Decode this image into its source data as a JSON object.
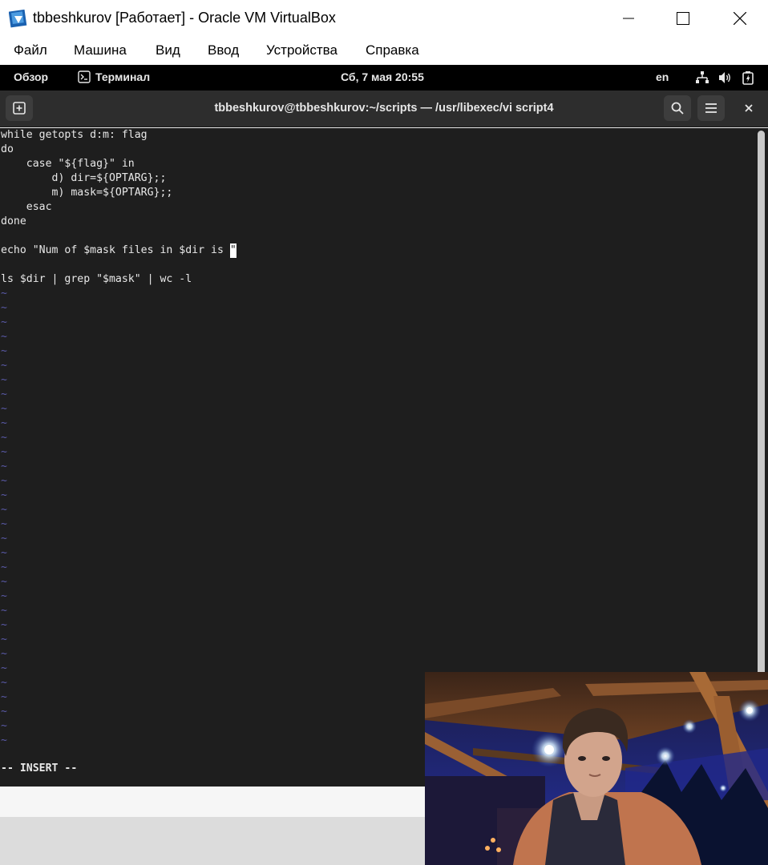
{
  "window": {
    "title": "tbbeshkurov [Работает] - Oracle VM VirtualBox",
    "app_icon": "virtualbox-icon",
    "controls": [
      "minimize-icon",
      "maximize-icon",
      "close-icon"
    ]
  },
  "menubar": {
    "items": [
      "Файл",
      "Машина",
      "Вид",
      "Ввод",
      "Устройства",
      "Справка"
    ]
  },
  "topbar": {
    "activities": "Обзор",
    "app_name": "Терминал",
    "clock": "Сб, 7 мая  20:55",
    "keyboard_layout": "en",
    "tray_icons": [
      "network-icon",
      "volume-icon",
      "battery-icon"
    ]
  },
  "terminal": {
    "title": "tbbeshkurov@tbbeshkurov:~/scripts — /usr/libexec/vi script4",
    "buttons": [
      "new-tab-icon",
      "search-icon",
      "hamburger-menu-icon",
      "close-icon"
    ],
    "lines": [
      "while getopts d:m: flag",
      "do",
      "    case \"${flag}\" in",
      "        d) dir=${OPTARG};;",
      "        m) mask=${OPTARG};;",
      "    esac",
      "done",
      "",
      "echo \"Num of $mask files in $dir is ",
      "",
      "ls $dir | grep \"$mask\" | wc -l"
    ],
    "cursor_line_index": 8,
    "cursor_char": "\"",
    "empty_line_marker": "~",
    "empty_line_count": 32,
    "mode": "-- INSERT --",
    "colors": {
      "background": "#1e1e1e",
      "foreground": "#e8e8e8",
      "tilde": "#5a5aa8",
      "header": "#2d2d2d"
    }
  },
  "webcam": {
    "description_icon": "webcam-overlay"
  }
}
